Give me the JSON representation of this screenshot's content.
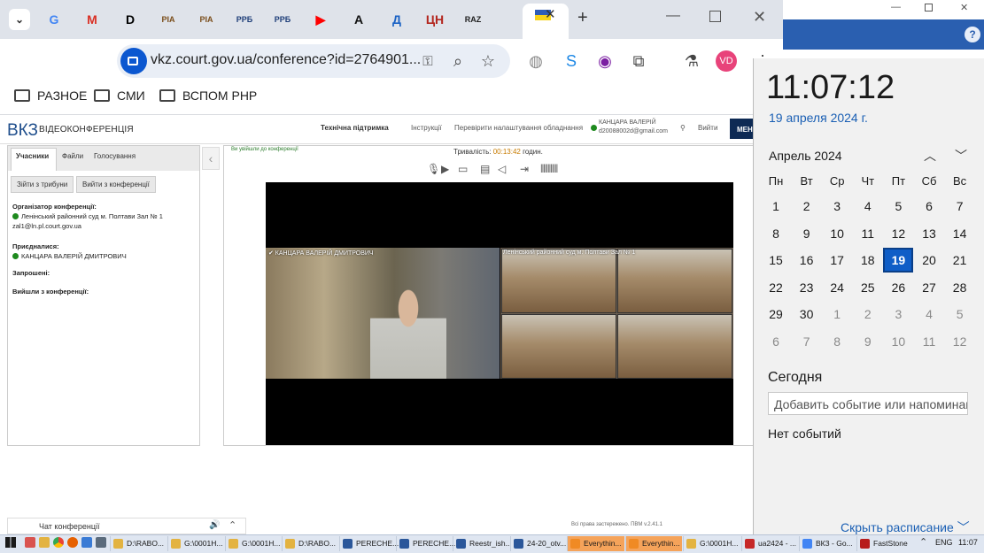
{
  "browser": {
    "tabs": [
      {
        "label": "G",
        "color": "#4285f4"
      },
      {
        "label": "M",
        "color": "#d93025"
      },
      {
        "label": "D",
        "color": "#000000"
      },
      {
        "label": "РІА",
        "color": "#7a4d1a"
      },
      {
        "label": "РІА",
        "color": "#7a4d1a"
      },
      {
        "label": "РРБ",
        "color": "#1f3f7a"
      },
      {
        "label": "РРБ",
        "color": "#1f3f7a"
      },
      {
        "label": "▶",
        "color": "#ff0000"
      },
      {
        "label": "А",
        "color": "#111111"
      },
      {
        "label": "Д",
        "color": "#1b62c4"
      },
      {
        "label": "ЦН",
        "color": "#b3261e"
      },
      {
        "label": "RAZ",
        "color": "#222222"
      }
    ],
    "url": "vkz.court.gov.ua/conference?id=2764901...",
    "profile_initials": "VD",
    "bookmarks": [
      "РАЗНОЕ",
      "СМИ",
      "ВСПОМ РНР"
    ]
  },
  "vkz": {
    "logo": "ВКЗ",
    "logo_sub": "ВІДЕОКОНФЕРЕНЦІЯ",
    "header_links": {
      "support": "Технічна підтримка",
      "instructions": "Інструкції",
      "check": "Перевірити налаштування обладнання",
      "user_name": "КАНЦАРА ВАЛЕРІЙ",
      "user_email": "d20088002d@gmail.com",
      "logout": "Вийти",
      "menu": "МЕНЮ"
    },
    "side_tabs": [
      "Учасники",
      "Файли",
      "Голосування"
    ],
    "side_buttons": [
      "Зійти з трибуни",
      "Вийти з конференції"
    ],
    "organizer_title": "Організатор конференції:",
    "organizer_name": "Ленінський районний суд м. Полтави Зал № 1",
    "organizer_email": "zal1@ln.pl.court.gov.ua",
    "joined_title": "Приєдналися:",
    "joined_name": "КАНЦАРА ВАЛЕРІЙ ДМИТРОВИЧ",
    "invited_title": "Запрошені:",
    "left_title": "Вийшли з конференції:",
    "joined_notice": "Ви увійшли до конференції",
    "duration_label": "Тривалість:",
    "duration_value": "00:13:42",
    "duration_unit": "годин.",
    "tile_left_label": "✔ КАНЦАРА ВАЛЕРІЙ ДМИТРОВИЧ",
    "tile_right_label": "Ленінський районний суд м. Полтави Зал № 1",
    "chat_label": "Чат конференції",
    "copyright": "Всі права застережено. ПВМ v.2.41.1"
  },
  "calendar": {
    "time": "11:07:12",
    "date_link": "19 апреля 2024 г.",
    "month": "Апрель 2024",
    "weekdays": [
      "Пн",
      "Вт",
      "Ср",
      "Чт",
      "Пт",
      "Сб",
      "Вс"
    ],
    "weeks": [
      [
        "1",
        "2",
        "3",
        "4",
        "5",
        "6",
        "7"
      ],
      [
        "8",
        "9",
        "10",
        "11",
        "12",
        "13",
        "14"
      ],
      [
        "15",
        "16",
        "17",
        "18",
        "19",
        "20",
        "21"
      ],
      [
        "22",
        "23",
        "24",
        "25",
        "26",
        "27",
        "28"
      ],
      [
        "29",
        "30",
        "1",
        "2",
        "3",
        "4",
        "5"
      ],
      [
        "6",
        "7",
        "8",
        "9",
        "10",
        "11",
        "12"
      ]
    ],
    "today": "19",
    "today_label": "Сегодня",
    "event_placeholder": "Добавить событие или напоминание",
    "no_events": "Нет событий",
    "hide_schedule": "Скрыть расписание"
  },
  "taskbar": {
    "items": [
      {
        "label": "D:\\RABO...",
        "color": "#e3b341"
      },
      {
        "label": "G:\\0001H...",
        "color": "#e3b341"
      },
      {
        "label": "G:\\0001H...",
        "color": "#e3b341"
      },
      {
        "label": "D:\\RABO...",
        "color": "#e3b341"
      },
      {
        "label": "PERECHE...",
        "color": "#2b579a"
      },
      {
        "label": "PERECHE...",
        "color": "#2b579a"
      },
      {
        "label": "Reestr_ish...",
        "color": "#2b579a"
      },
      {
        "label": "24-20_otv...",
        "color": "#2b579a"
      },
      {
        "label": "Everythin...",
        "color": "#f08a24"
      },
      {
        "label": "Everythin...",
        "color": "#f08a24"
      },
      {
        "label": "G:\\0001H...",
        "color": "#e3b341"
      },
      {
        "label": "ua2424 - ...",
        "color": "#c62828"
      },
      {
        "label": "ВКЗ - Go...",
        "color": "#4285f4"
      },
      {
        "label": "FastStone",
        "color": "#b71c1c"
      }
    ],
    "lang": "ENG",
    "time": "11:07"
  }
}
